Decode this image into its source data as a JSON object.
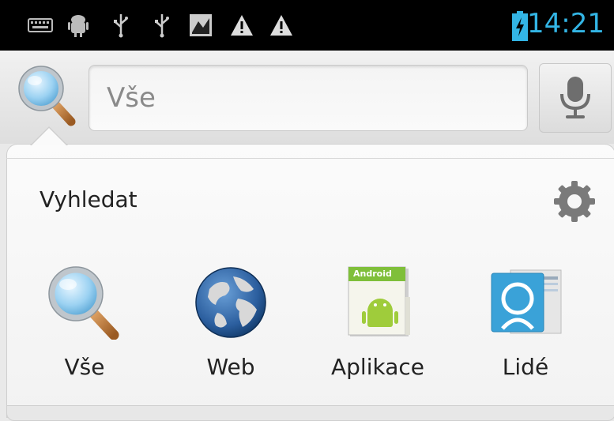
{
  "status_bar": {
    "time": "14:21",
    "icons": [
      "keyboard-icon",
      "android-debug-icon",
      "usb-icon",
      "usb-icon",
      "image-notification-icon",
      "warning-icon",
      "warning-icon",
      "battery-charging-icon"
    ],
    "accent": "#33b5e5"
  },
  "search": {
    "placeholder": "Vše",
    "mic_icon": "microphone-icon",
    "search_icon": "magnifier-icon"
  },
  "panel": {
    "title": "Vyhledat",
    "settings_icon": "settings-gear-icon",
    "categories": [
      {
        "label": "Vše",
        "icon": "magnifier-icon"
      },
      {
        "label": "Web",
        "icon": "globe-icon"
      },
      {
        "label": "Aplikace",
        "icon": "android-app-icon",
        "badge": "Android"
      },
      {
        "label": "Lidé",
        "icon": "contacts-icon"
      }
    ]
  }
}
